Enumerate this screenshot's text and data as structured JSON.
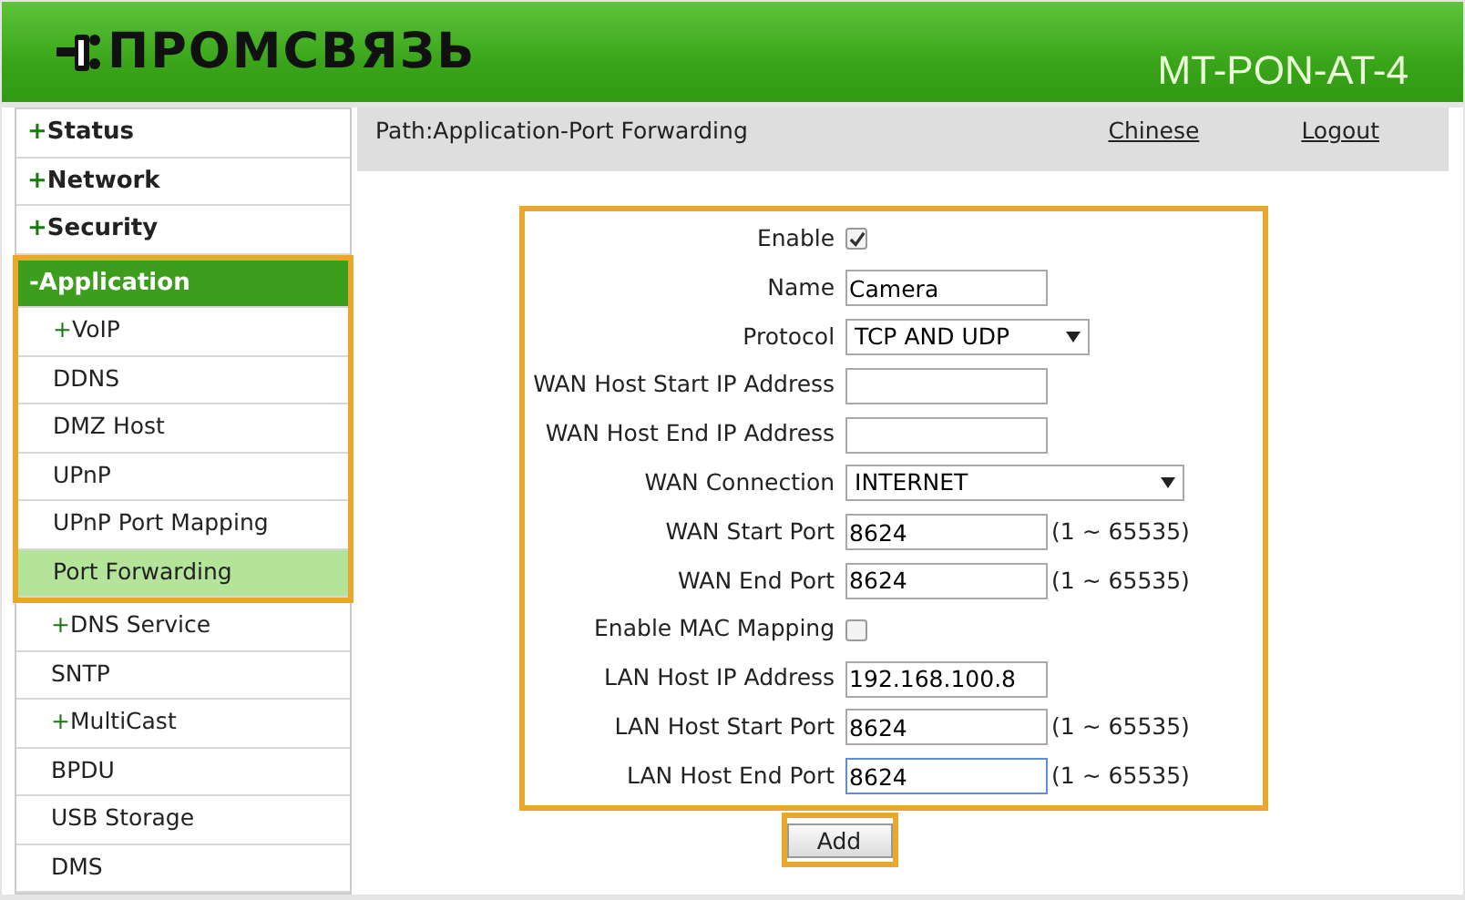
{
  "header": {
    "logo_text": "ПРОМСВЯЗЬ",
    "model": "MT-PON-AT-4"
  },
  "sidebar": {
    "items": [
      {
        "kind": "section",
        "prefix": "+",
        "label": "Status",
        "selected": false,
        "highlighted": false
      },
      {
        "kind": "section",
        "prefix": "+",
        "label": "Network",
        "selected": false,
        "highlighted": false
      },
      {
        "kind": "section",
        "prefix": "+",
        "label": "Security",
        "selected": false,
        "highlighted": false
      },
      {
        "kind": "section",
        "prefix": "-",
        "label": "Application",
        "selected": true,
        "highlighted": true
      },
      {
        "kind": "sub",
        "prefix": "+",
        "label": "VoIP",
        "selected": false,
        "highlighted": true
      },
      {
        "kind": "sub",
        "label": "DDNS",
        "selected": false,
        "highlighted": true
      },
      {
        "kind": "sub",
        "label": "DMZ Host",
        "selected": false,
        "highlighted": true
      },
      {
        "kind": "sub",
        "label": "UPnP",
        "selected": false,
        "highlighted": true
      },
      {
        "kind": "sub",
        "label": "UPnP Port Mapping",
        "selected": false,
        "highlighted": true
      },
      {
        "kind": "sub",
        "label": "Port Forwarding",
        "selected": true,
        "highlighted": true
      },
      {
        "kind": "sub",
        "prefix": "+",
        "label": "DNS Service",
        "selected": false,
        "highlighted": false
      },
      {
        "kind": "sub",
        "label": "SNTP",
        "selected": false,
        "highlighted": false
      },
      {
        "kind": "sub",
        "prefix": "+",
        "label": "MultiCast",
        "selected": false,
        "highlighted": false
      },
      {
        "kind": "sub",
        "label": "BPDU",
        "selected": false,
        "highlighted": false
      },
      {
        "kind": "sub",
        "label": "USB Storage",
        "selected": false,
        "highlighted": false
      },
      {
        "kind": "sub",
        "label": "DMS",
        "selected": false,
        "highlighted": false
      }
    ]
  },
  "path_bar": {
    "path": "Path:Application-Port Forwarding",
    "links": [
      "Chinese",
      "Logout"
    ]
  },
  "form": {
    "highlighted": true,
    "rows": [
      {
        "kind": "checkbox",
        "label": "Enable",
        "checked": true
      },
      {
        "kind": "text",
        "label": "Name",
        "value": "Camera"
      },
      {
        "kind": "select",
        "label": "Protocol",
        "value": "TCP AND UDP",
        "wide": false
      },
      {
        "kind": "text",
        "label": "WAN Host Start IP Address"
      },
      {
        "kind": "text",
        "label": "WAN Host End IP Address"
      },
      {
        "kind": "select",
        "label": "WAN Connection",
        "value": "INTERNET",
        "wide": true
      },
      {
        "kind": "text",
        "label": "WAN Start Port",
        "value": "8624",
        "hint": "(1 ~ 65535)"
      },
      {
        "kind": "text",
        "label": "WAN End Port",
        "value": "8624",
        "hint": "(1 ~ 65535)"
      },
      {
        "kind": "checkbox",
        "label": "Enable MAC Mapping",
        "checked": false
      },
      {
        "kind": "text",
        "label": "LAN Host IP Address",
        "value": "192.168.100.8"
      },
      {
        "kind": "text",
        "label": "LAN Host Start Port",
        "value": "8624",
        "hint": "(1 ~ 65535)"
      },
      {
        "kind": "text",
        "label": "LAN Host End Port",
        "value": "8624",
        "hint": "(1 ~ 65535)",
        "focused": true
      }
    ]
  },
  "add_button": {
    "label": "Add",
    "highlighted": true
  }
}
